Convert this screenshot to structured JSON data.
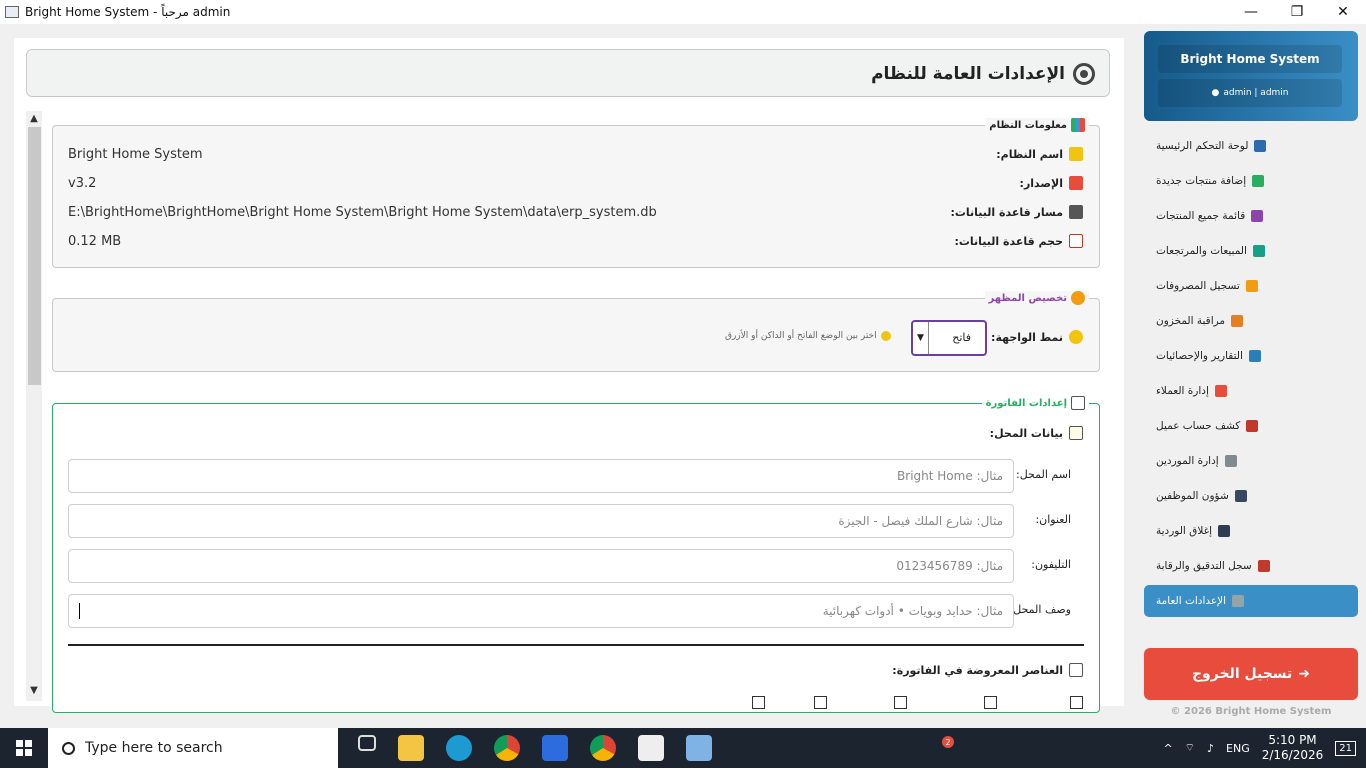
{
  "window": {
    "title": "Bright Home System - مرحباً admin"
  },
  "header": {
    "title": "الإعدادات العامة للنظام"
  },
  "system_info": {
    "legend": "معلومات النظام",
    "rows": [
      {
        "label": "اسم النظام:",
        "value": "Bright Home System"
      },
      {
        "label": "الإصدار:",
        "value": "v3.2"
      },
      {
        "label": "مسار قاعدة البيانات:",
        "value": "E:\\BrightHome\\BrightHome\\Bright Home System\\Bright Home System\\data\\erp_system.db"
      },
      {
        "label": "حجم قاعدة البيانات:",
        "value": "0.12 MB"
      }
    ]
  },
  "appearance": {
    "legend": "تخصيص المظهر",
    "theme_label": "نمط الواجهة:",
    "theme_value": "فاتح",
    "hint": "اختر بين الوضع الفاتح أو الداكن أو الأزرق"
  },
  "invoice": {
    "legend": "إعدادات الفاتورة",
    "shop_section": "بيانات المحل:",
    "fields": [
      {
        "label": "اسم المحل:",
        "placeholder": "مثال: Bright Home"
      },
      {
        "label": "العنوان:",
        "placeholder": "مثال: شارع الملك فيصل - الجيزة"
      },
      {
        "label": "التليفون:",
        "placeholder": "مثال: 0123456789"
      },
      {
        "label": "وصف المحل:",
        "placeholder": "مثال: حدايد وبويات • أدوات كهربائية"
      }
    ],
    "elements_section": "العناصر المعروضة في الفاتورة:"
  },
  "sidebar": {
    "brand": "Bright Home System",
    "user": "admin | admin",
    "items": [
      {
        "label": "لوحة التحكم الرئيسية",
        "color": "#2b6cb0"
      },
      {
        "label": "إضافة منتجات جديدة",
        "color": "#27ae60"
      },
      {
        "label": "قائمة جميع المنتجات",
        "color": "#8e44ad"
      },
      {
        "label": "المبيعات والمرتجعات",
        "color": "#16a085"
      },
      {
        "label": "تسجيل المصروفات",
        "color": "#f39c12"
      },
      {
        "label": "مراقبة المخزون",
        "color": "#e67e22"
      },
      {
        "label": "التقارير والإحصائيات",
        "color": "#2980b9"
      },
      {
        "label": "إدارة العملاء",
        "color": "#e74c3c"
      },
      {
        "label": "كشف حساب عميل",
        "color": "#c0392b"
      },
      {
        "label": "إدارة الموردين",
        "color": "#7f8c8d"
      },
      {
        "label": "شؤون الموظفين",
        "color": "#34495e"
      },
      {
        "label": "إغلاق الوردية",
        "color": "#2c3e50"
      },
      {
        "label": "سجل التدقيق والرقابة",
        "color": "#c0392b"
      },
      {
        "label": "الإعدادات العامة",
        "color": "#95a5a6"
      }
    ],
    "logout": "تسجيل الخروج",
    "copyright": "© 2026 Bright Home System"
  },
  "taskbar": {
    "search_placeholder": "Type here to search",
    "lang": "ENG",
    "time": "5:10 PM",
    "date": "2/16/2026",
    "notif": "21",
    "badge": "2"
  }
}
